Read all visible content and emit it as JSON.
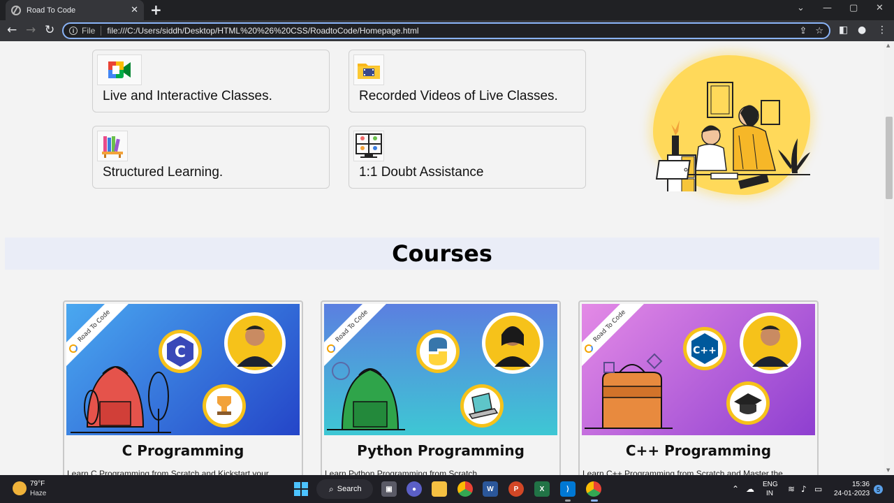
{
  "browser": {
    "tab_title": "Road To Code",
    "url_prefix": "File",
    "url": "file:///C:/Users/siddh/Desktop/HTML%20%26%20CSS/RoadtoCode/Homepage.html"
  },
  "features": [
    {
      "label": "Live and Interactive Classes.",
      "icon": "meet-icon"
    },
    {
      "label": "Recorded Videos of Live Classes.",
      "icon": "video-folder-icon"
    },
    {
      "label": "Structured Learning.",
      "icon": "books-icon"
    },
    {
      "label": "1:1 Doubt Assistance",
      "icon": "video-call-grid-icon"
    }
  ],
  "courses": {
    "heading": "Courses",
    "ribbon_text": "Road To Code",
    "cards": [
      {
        "title": "C Programming",
        "description": "Learn C Programming from Scratch and Kickstart your",
        "lang_badge": "C",
        "colors": [
          "#4aa8f0",
          "#2445c8"
        ]
      },
      {
        "title": "Python Programming",
        "description": "Learn Python Programming from Scratch",
        "lang_badge": "",
        "colors": [
          "#5b7fe0",
          "#3ec7d4"
        ]
      },
      {
        "title": "C++ Programming",
        "description": "Learn C++ Programming from Scratch and Master the",
        "lang_badge": "C++",
        "colors": [
          "#e48ae6",
          "#8e3fd0"
        ]
      }
    ]
  },
  "taskbar": {
    "weather_temp": "79°F",
    "weather_desc": "Haze",
    "search_label": "Search",
    "lang_top": "ENG",
    "lang_bottom": "IN",
    "time": "15:36",
    "date": "24-01-2023",
    "notifications": "5"
  }
}
